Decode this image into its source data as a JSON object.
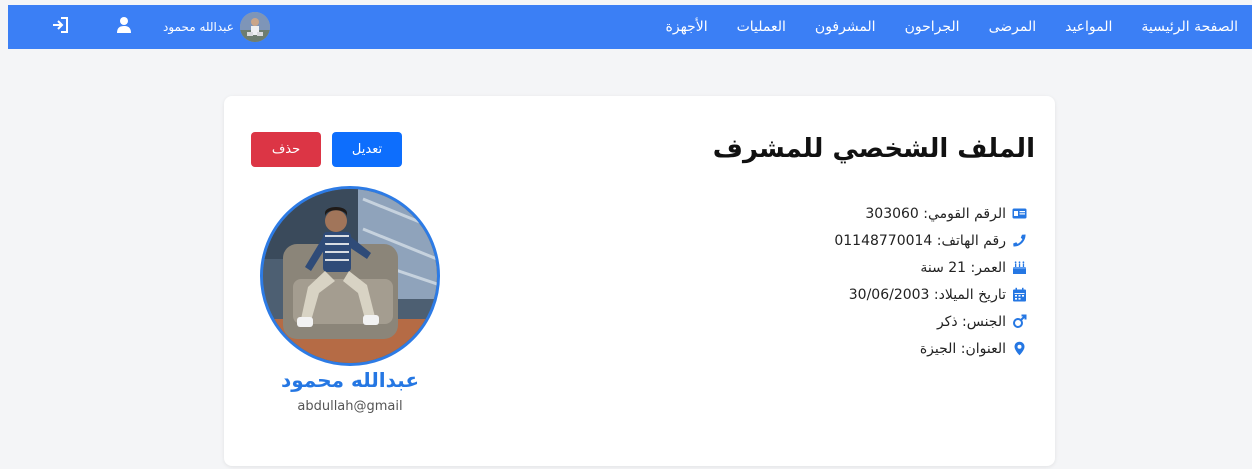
{
  "navbar": {
    "links": [
      "الصفحة الرئيسية",
      "المواعيد",
      "المرضى",
      "الجراحون",
      "المشرفون",
      "العمليات",
      "الأجهزة"
    ],
    "username": "عبدالله محمود"
  },
  "profile": {
    "title": "الملف الشخصي للمشرف",
    "edit_label": "تعديل",
    "delete_label": "حذف",
    "name": "عبدالله محمود",
    "email": "abdullah@gmail",
    "fields": [
      {
        "icon": "id-card-icon",
        "text": "الرقم القومي: 303060"
      },
      {
        "icon": "phone-icon",
        "text": "رقم الهاتف: 01148770014"
      },
      {
        "icon": "birthday-cake-icon",
        "text": "العمر: 21 سنة"
      },
      {
        "icon": "calendar-icon",
        "text": "تاريخ الميلاد: 30/06/2003"
      },
      {
        "icon": "male-gender-icon",
        "text": "الجنس: ذكر"
      },
      {
        "icon": "location-pin-icon",
        "text": "العنوان: الجيزة"
      }
    ]
  },
  "colors": {
    "navbar": "#3b7ff5",
    "accent": "#2577e3",
    "edit_button": "#0d6efd",
    "delete_button": "#dc3545"
  }
}
